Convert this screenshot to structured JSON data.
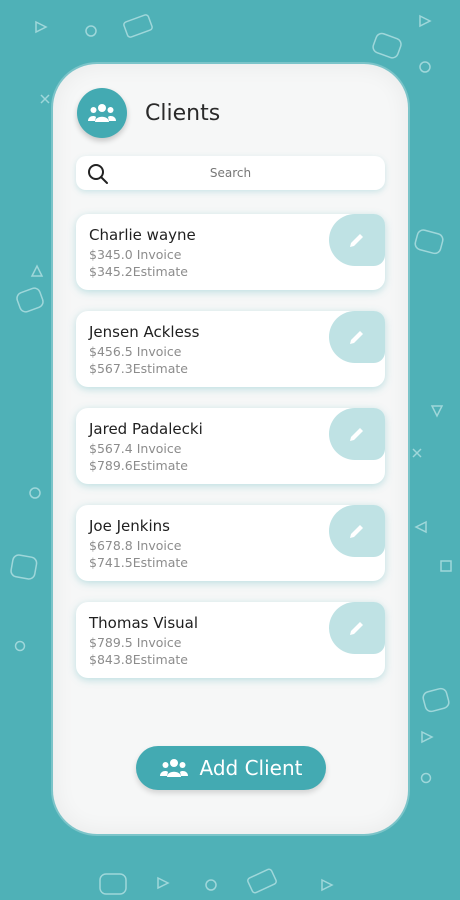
{
  "header": {
    "title": "Clients",
    "avatar_icon": "users-icon"
  },
  "search": {
    "placeholder": "Search",
    "icon": "search-icon"
  },
  "clients": [
    {
      "name": "Charlie wayne",
      "invoice": "$345.0 Invoice",
      "estimate": "$345.2Estimate"
    },
    {
      "name": "Jensen Ackless",
      "invoice": "$456.5 Invoice",
      "estimate": "$567.3Estimate"
    },
    {
      "name": "Jared Padalecki",
      "invoice": "$567.4 Invoice",
      "estimate": "$789.6Estimate"
    },
    {
      "name": "Joe Jenkins",
      "invoice": "$678.8 Invoice",
      "estimate": "$741.5Estimate"
    },
    {
      "name": "Thomas Visual",
      "invoice": "$789.5 Invoice",
      "estimate": "$843.8Estimate"
    }
  ],
  "add_button": {
    "label": "Add Client",
    "icon": "users-icon"
  },
  "colors": {
    "background": "#4fb1b7",
    "accent": "#43aab2",
    "edit": "#bfe2e4",
    "card": "#f6f7f7"
  }
}
